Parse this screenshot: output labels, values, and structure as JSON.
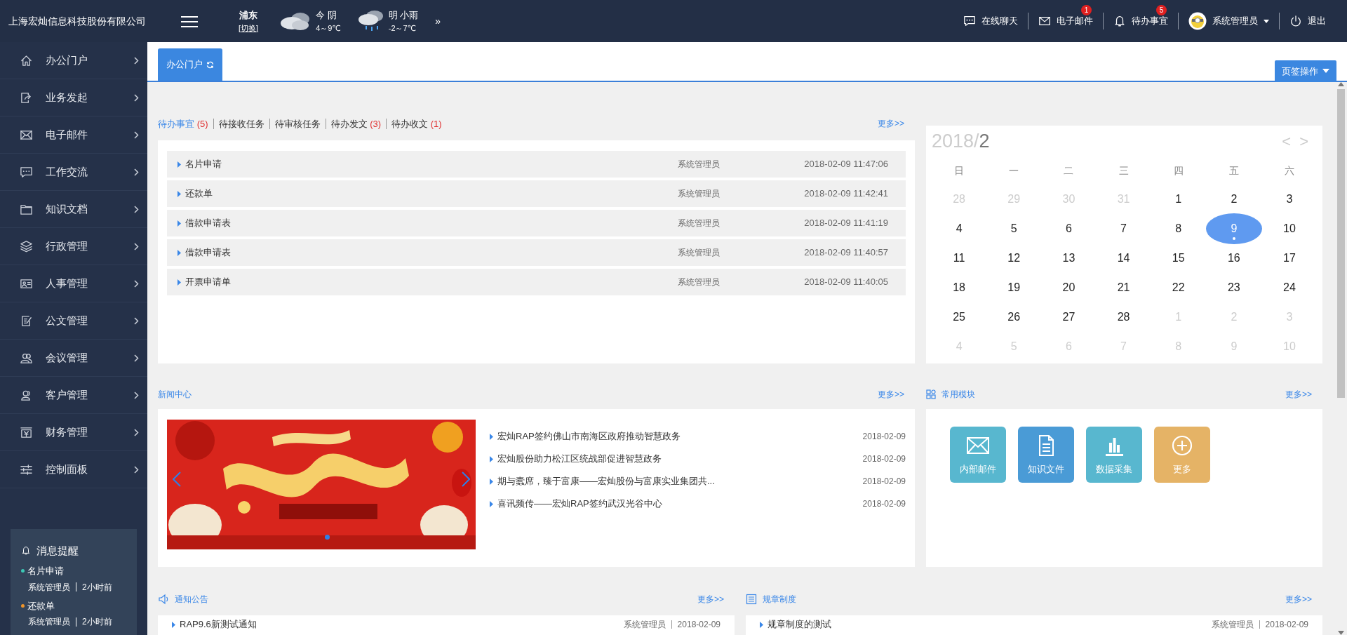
{
  "header": {
    "company": "上海宏灿信息科技股份有限公司",
    "location": {
      "city": "浦东",
      "switch": "[切换]"
    },
    "weather": [
      {
        "kind": "cloudy",
        "label": "今 阴",
        "temp": "4～9℃"
      },
      {
        "kind": "rain",
        "label": "明 小雨",
        "temp": "-2～7℃"
      }
    ],
    "more": "»",
    "actions": [
      {
        "kind": "chat",
        "label": "在线聊天"
      },
      {
        "kind": "mail",
        "label": "电子邮件",
        "badge": "1"
      },
      {
        "kind": "bell",
        "label": "待办事宜",
        "badge": "5"
      }
    ],
    "user": "系统管理员",
    "logout": "退出"
  },
  "sidebar": {
    "items": [
      {
        "kind": "home",
        "label": "办公门户"
      },
      {
        "kind": "share",
        "label": "业务发起"
      },
      {
        "kind": "mail",
        "label": "电子邮件"
      },
      {
        "kind": "chat",
        "label": "工作交流"
      },
      {
        "kind": "folder",
        "label": "知识文档"
      },
      {
        "kind": "layers",
        "label": "行政管理"
      },
      {
        "kind": "idcard",
        "label": "人事管理"
      },
      {
        "kind": "doc",
        "label": "公文管理"
      },
      {
        "kind": "group",
        "label": "会议管理"
      },
      {
        "kind": "user",
        "label": "客户管理"
      },
      {
        "kind": "finance",
        "label": "财务管理"
      },
      {
        "kind": "sliders",
        "label": "控制面板"
      }
    ],
    "reminder": {
      "title": "消息提醒",
      "items": [
        {
          "title": "名片申请",
          "color": "#3cc7b4",
          "user": "系统管理员",
          "time": "2小时前"
        },
        {
          "title": "还款单",
          "color": "#f0952a",
          "user": "系统管理员",
          "time": "2小时前"
        }
      ]
    }
  },
  "tabs": [
    {
      "label": "办公门户",
      "selected": true
    }
  ],
  "tab_actions": "页签操作",
  "todo": {
    "tabs": [
      {
        "label": "待办事宜",
        "count": "(5)",
        "selected": true
      },
      {
        "label": "待接收任务",
        "selected": false
      },
      {
        "label": "待审核任务",
        "selected": false
      },
      {
        "label": "待办发文",
        "count": "(3)",
        "selected": false
      },
      {
        "label": "待办收文",
        "count": "(1)",
        "selected": false
      }
    ],
    "more": "更多>>",
    "rows": [
      {
        "title": "名片申请",
        "user": "系统管理员",
        "time": "2018-02-09 11:47:06"
      },
      {
        "title": "还款单",
        "user": "系统管理员",
        "time": "2018-02-09 11:42:41"
      },
      {
        "title": "借款申请表",
        "user": "系统管理员",
        "time": "2018-02-09 11:41:19"
      },
      {
        "title": "借款申请表",
        "user": "系统管理员",
        "time": "2018-02-09 11:40:57"
      },
      {
        "title": "开票申请单",
        "user": "系统管理员",
        "time": "2018-02-09 11:40:05"
      }
    ]
  },
  "calendar": {
    "year": "2018/",
    "month": "2",
    "prev": "<",
    "next": ">",
    "weekdays": [
      "日",
      "一",
      "二",
      "三",
      "四",
      "五",
      "六"
    ],
    "days": [
      {
        "label": "28",
        "muted": true,
        "selected": false,
        "event": false
      },
      {
        "label": "29",
        "muted": true,
        "selected": false,
        "event": false
      },
      {
        "label": "30",
        "muted": true,
        "selected": false,
        "event": false
      },
      {
        "label": "31",
        "muted": true,
        "selected": false,
        "event": false
      },
      {
        "label": "1",
        "muted": false,
        "selected": false,
        "event": false
      },
      {
        "label": "2",
        "muted": false,
        "selected": false,
        "event": false
      },
      {
        "label": "3",
        "muted": false,
        "selected": false,
        "event": false
      },
      {
        "label": "4",
        "muted": false,
        "selected": false,
        "event": false
      },
      {
        "label": "5",
        "muted": false,
        "selected": false,
        "event": false
      },
      {
        "label": "6",
        "muted": false,
        "selected": false,
        "event": false
      },
      {
        "label": "7",
        "muted": false,
        "selected": false,
        "event": false
      },
      {
        "label": "8",
        "muted": false,
        "selected": false,
        "event": false
      },
      {
        "label": "9",
        "muted": false,
        "selected": true,
        "event": true
      },
      {
        "label": "10",
        "muted": false,
        "selected": false,
        "event": false
      },
      {
        "label": "11",
        "muted": false,
        "selected": false,
        "event": false
      },
      {
        "label": "12",
        "muted": false,
        "selected": false,
        "event": false
      },
      {
        "label": "13",
        "muted": false,
        "selected": false,
        "event": false
      },
      {
        "label": "14",
        "muted": false,
        "selected": false,
        "event": false
      },
      {
        "label": "15",
        "muted": false,
        "selected": false,
        "event": false
      },
      {
        "label": "16",
        "muted": false,
        "selected": false,
        "event": false
      },
      {
        "label": "17",
        "muted": false,
        "selected": false,
        "event": false
      },
      {
        "label": "18",
        "muted": false,
        "selected": false,
        "event": false
      },
      {
        "label": "19",
        "muted": false,
        "selected": false,
        "event": false
      },
      {
        "label": "20",
        "muted": false,
        "selected": false,
        "event": false
      },
      {
        "label": "21",
        "muted": false,
        "selected": false,
        "event": false
      },
      {
        "label": "22",
        "muted": false,
        "selected": false,
        "event": false
      },
      {
        "label": "23",
        "muted": false,
        "selected": false,
        "event": false
      },
      {
        "label": "24",
        "muted": false,
        "selected": false,
        "event": false
      },
      {
        "label": "25",
        "muted": false,
        "selected": false,
        "event": false
      },
      {
        "label": "26",
        "muted": false,
        "selected": false,
        "event": false
      },
      {
        "label": "27",
        "muted": false,
        "selected": false,
        "event": false
      },
      {
        "label": "28",
        "muted": false,
        "selected": false,
        "event": false
      },
      {
        "label": "1",
        "muted": true,
        "selected": false,
        "event": false
      },
      {
        "label": "2",
        "muted": true,
        "selected": false,
        "event": false
      },
      {
        "label": "3",
        "muted": true,
        "selected": false,
        "event": false
      },
      {
        "label": "4",
        "muted": true,
        "selected": false,
        "event": false
      },
      {
        "label": "5",
        "muted": true,
        "selected": false,
        "event": false
      },
      {
        "label": "6",
        "muted": true,
        "selected": false,
        "event": false
      },
      {
        "label": "7",
        "muted": true,
        "selected": false,
        "event": false
      },
      {
        "label": "8",
        "muted": true,
        "selected": false,
        "event": false
      },
      {
        "label": "9",
        "muted": true,
        "selected": false,
        "event": false
      },
      {
        "label": "10",
        "muted": true,
        "selected": false,
        "event": false
      }
    ]
  },
  "news": {
    "title": "新闻中心",
    "more": "更多>>",
    "items": [
      {
        "title": "宏灿RAP签约佛山市南海区政府推动智慧政务",
        "date": "2018-02-09"
      },
      {
        "title": "宏灿股份助力松江区统战部促进智慧政务",
        "date": "2018-02-09"
      },
      {
        "title": "期与蠹席，臻于富康——宏灿股份与富康实业集团共...",
        "date": "2018-02-09"
      },
      {
        "title": "喜讯频传——宏灿RAP签约武汉光谷中心",
        "date": "2018-02-09"
      }
    ]
  },
  "modules": {
    "title": "常用模块",
    "more": "更多>>",
    "tiles": [
      {
        "kind": "mail",
        "label": "内部邮件",
        "color": "#58b7cf"
      },
      {
        "kind": "file",
        "label": "知识文件",
        "color": "#4a9bd6"
      },
      {
        "kind": "chart",
        "label": "数据采集",
        "color": "#58b7cf"
      },
      {
        "kind": "plus",
        "label": "更多",
        "color": "#e5b366"
      }
    ]
  },
  "boards": [
    {
      "kind": "speaker",
      "title": "通知公告",
      "more": "更多>>",
      "rows": [
        {
          "title": "RAP9.6新测试通知",
          "user": "系统管理员",
          "date": "2018-02-09"
        }
      ]
    },
    {
      "kind": "list",
      "title": "规章制度",
      "more": "更多>>",
      "rows": [
        {
          "title": "规章制度的测试",
          "user": "系统管理员",
          "date": "2018-02-09"
        }
      ]
    }
  ]
}
